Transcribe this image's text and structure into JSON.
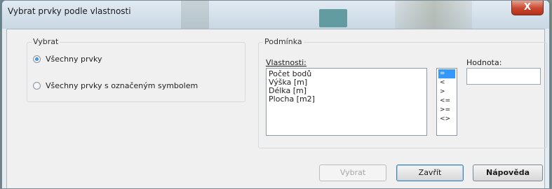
{
  "window": {
    "title": "Vybrat prvky podle vlastnosti",
    "close_glyph": "X"
  },
  "select_group": {
    "label": "Vybrat",
    "options": [
      {
        "label": "Všechny prvky",
        "checked": true
      },
      {
        "label": "Všechny prvky s označeným symbolem",
        "checked": false
      }
    ]
  },
  "condition_group": {
    "label": "Podmínka",
    "properties_label": "Vlastnosti:",
    "properties": [
      "Počet bodů",
      "Výška [m]",
      "Délka [m]",
      "Plocha [m2]"
    ],
    "operators": [
      "=",
      "<",
      ">",
      "<=",
      ">=",
      "<>"
    ],
    "selected_operator": "=",
    "value_label": "Hodnota:",
    "value": ""
  },
  "buttons": {
    "select_label": "Vybrat",
    "close_label": "Zavřít",
    "help_label": "Nápověda"
  }
}
